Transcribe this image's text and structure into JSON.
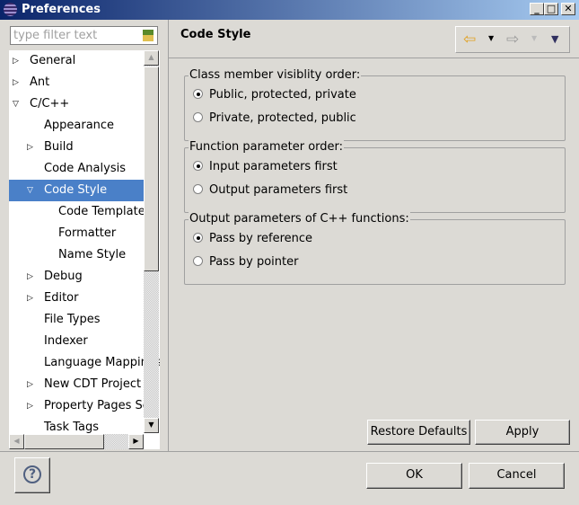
{
  "window": {
    "title": "Preferences"
  },
  "filter": {
    "placeholder": "type filter text"
  },
  "tree": [
    {
      "label": "General",
      "indent": 0,
      "twisty": "collapsed"
    },
    {
      "label": "Ant",
      "indent": 0,
      "twisty": "collapsed"
    },
    {
      "label": "C/C++",
      "indent": 0,
      "twisty": "expanded"
    },
    {
      "label": "Appearance",
      "indent": 1,
      "twisty": ""
    },
    {
      "label": "Build",
      "indent": 1,
      "twisty": "collapsed"
    },
    {
      "label": "Code Analysis",
      "indent": 1,
      "twisty": ""
    },
    {
      "label": "Code Style",
      "indent": 1,
      "twisty": "expanded",
      "selected": true
    },
    {
      "label": "Code Templates",
      "indent": 2,
      "twisty": ""
    },
    {
      "label": "Formatter",
      "indent": 2,
      "twisty": ""
    },
    {
      "label": "Name Style",
      "indent": 2,
      "twisty": ""
    },
    {
      "label": "Debug",
      "indent": 1,
      "twisty": "collapsed"
    },
    {
      "label": "Editor",
      "indent": 1,
      "twisty": "collapsed"
    },
    {
      "label": "File Types",
      "indent": 1,
      "twisty": ""
    },
    {
      "label": "Indexer",
      "indent": 1,
      "twisty": ""
    },
    {
      "label": "Language Mappings",
      "indent": 1,
      "twisty": ""
    },
    {
      "label": "New CDT Project Wizard",
      "indent": 1,
      "twisty": "collapsed"
    },
    {
      "label": "Property Pages Settings",
      "indent": 1,
      "twisty": "collapsed"
    },
    {
      "label": "Task Tags",
      "indent": 1,
      "twisty": ""
    }
  ],
  "page": {
    "title": "Code Style"
  },
  "groups": [
    {
      "label": "Class member visiblity order:",
      "options": [
        "Public, protected, private",
        "Private, protected, public"
      ],
      "selected": 0
    },
    {
      "label": "Function parameter order:",
      "options": [
        "Input parameters first",
        "Output parameters first"
      ],
      "selected": 0
    },
    {
      "label": "Output parameters of C++ functions:",
      "options": [
        "Pass by reference",
        "Pass by pointer"
      ],
      "selected": 0
    }
  ],
  "buttons": {
    "restore": "Restore Defaults",
    "apply": "Apply",
    "ok": "OK",
    "cancel": "Cancel",
    "help": "?"
  }
}
